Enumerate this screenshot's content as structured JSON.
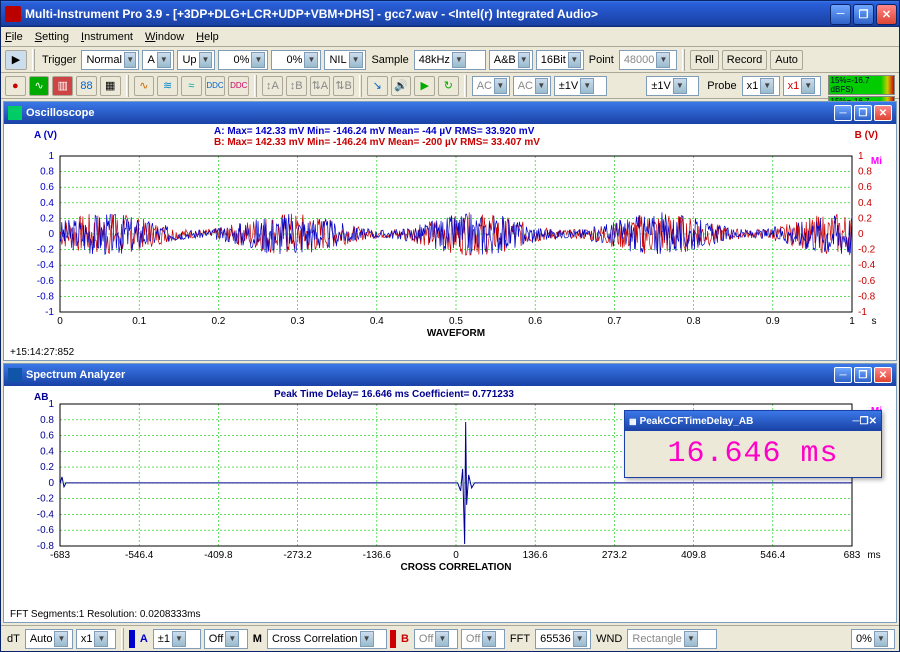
{
  "app": {
    "title": "Multi-Instrument Pro 3.9   -   [+3DP+DLG+LCR+UDP+VBM+DHS]   -   gcc7.wav   -   <Intel(r) Integrated Audio>"
  },
  "menu": {
    "file": "File",
    "setting": "Setting",
    "instrument": "Instrument",
    "window": "Window",
    "help": "Help"
  },
  "tb1": {
    "trigger": "Trigger",
    "trigger_mode": "Normal",
    "edge": "A",
    "slope": "Up",
    "level1": "0%",
    "level2": "0%",
    "pre": "NIL",
    "sample": "Sample",
    "sample_rate": "48kHz",
    "ab": "A&B",
    "bits": "16Bit",
    "point": "Point",
    "point_val": "48000",
    "roll": "Roll",
    "record": "Record",
    "auto": "Auto"
  },
  "tb2": {
    "ac1": "AC",
    "ac2": "AC",
    "v1": "±1V",
    "v2": "±1V",
    "probe": "Probe",
    "probe1": "x1",
    "probe2": "x1",
    "level_text": "15%=-16.7 dBFS)"
  },
  "osc": {
    "title": "Oscilloscope",
    "left_axis": "A (V)",
    "right_axis": "B (V)",
    "xlabel": "WAVEFORM",
    "xunit": "s",
    "timestamp": "+15:14:27:852",
    "stats_a": "A: Max=    142.33  mV   Min=   -146.24  mV   Mean=         -44  µV   RMS=     33.920  mV",
    "stats_b": "B: Max=    142.33  mV   Min=   -146.24  mV   Mean=       -200  µV   RMS=     33.407  mV"
  },
  "spec": {
    "title": "Spectrum Analyzer",
    "left_axis": "AB",
    "header": "Peak Time Delay=    16.646  ms   Coefficient=   0.771233",
    "xlabel": "CROSS CORRELATION",
    "xunit": "ms",
    "footer": "FFT Segments:1     Resolution: 0.0208333ms"
  },
  "peak": {
    "title": "PeakCCFTimeDelay_AB",
    "value": "16.646 ms"
  },
  "bb": {
    "dt": "dT",
    "auto": "Auto",
    "x1": "x1",
    "a": "A",
    "pm1": "±1",
    "off": "Off",
    "m": "M",
    "cc": "Cross Correlation",
    "b": "B",
    "fft": "FFT",
    "fft_val": "65536",
    "wnd": "WND",
    "wnd_val": "Rectangle",
    "pct": "0%"
  },
  "chart_data": [
    {
      "type": "line",
      "name": "oscilloscope",
      "title": "WAVEFORM",
      "xlabel": "s",
      "ylabel": "A (V) / B (V)",
      "xlim": [
        0,
        1
      ],
      "ylim": [
        -1,
        1
      ],
      "xticks": [
        0,
        0.1,
        0.2,
        0.3,
        0.4,
        0.5,
        0.6,
        0.7,
        0.8,
        0.9,
        1
      ],
      "yticks": [
        -1,
        -0.8,
        -0.6,
        -0.4,
        -0.2,
        0,
        0.2,
        0.4,
        0.6,
        0.8,
        1
      ],
      "series": [
        {
          "name": "A",
          "color": "#0000c8",
          "max_mV": 142.33,
          "min_mV": -146.24,
          "mean_uV": -44,
          "rms_mV": 33.92
        },
        {
          "name": "B",
          "color": "#c80000",
          "max_mV": 142.33,
          "min_mV": -146.24,
          "mean_uV": -200,
          "rms_mV": 33.407
        }
      ],
      "note": "dense noise-like waveform, amplitude ≈ ±0.15 V over full 0–1 s window"
    },
    {
      "type": "line",
      "name": "cross_correlation",
      "title": "CROSS CORRELATION",
      "xlabel": "ms",
      "ylabel": "AB",
      "xlim": [
        -683,
        683
      ],
      "ylim": [
        -0.8,
        1
      ],
      "xticks": [
        -683,
        -546.4,
        -409.8,
        -273.2,
        -136.6,
        0,
        136.6,
        273.2,
        409.8,
        546.4,
        683
      ],
      "yticks": [
        -0.8,
        -0.6,
        -0.4,
        -0.2,
        0,
        0.2,
        0.4,
        0.6,
        0.8,
        1
      ],
      "peak": {
        "time_delay_ms": 16.646,
        "coefficient": 0.771233
      },
      "series": [
        {
          "name": "AB",
          "color": "#000090",
          "shape": "single narrow peak ≈0.77 at ~16.6 ms, near-zero elsewhere"
        }
      ]
    }
  ]
}
